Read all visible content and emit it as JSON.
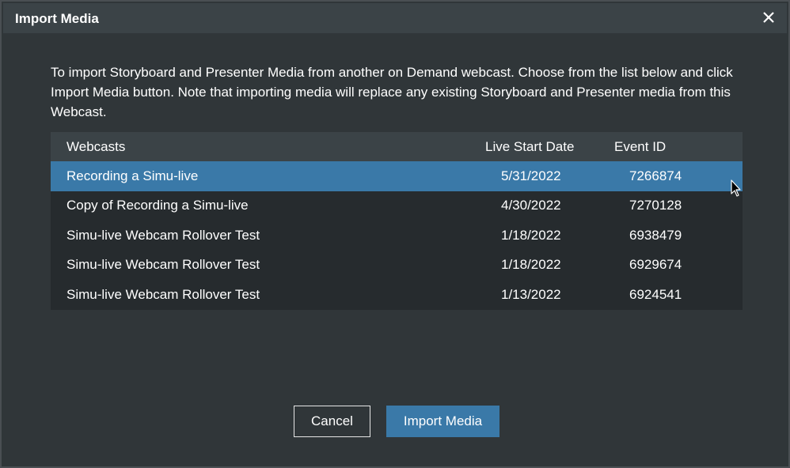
{
  "dialog": {
    "title": "Import Media",
    "description": "To import Storyboard and Presenter Media from another on Demand webcast. Choose from the list below and click Import Media button. Note that importing media will replace any existing Storyboard and Presenter media from this Webcast."
  },
  "table": {
    "headers": {
      "webcasts": "Webcasts",
      "live_start_date": "Live Start Date",
      "event_id": "Event ID"
    },
    "rows": [
      {
        "name": "Recording a Simu-live",
        "date": "5/31/2022",
        "event_id": "7266874",
        "selected": true
      },
      {
        "name": "Copy of Recording a Simu-live",
        "date": "4/30/2022",
        "event_id": "7270128",
        "selected": false
      },
      {
        "name": "Simu-live Webcam Rollover Test",
        "date": "1/18/2022",
        "event_id": "6938479",
        "selected": false
      },
      {
        "name": "Simu-live Webcam Rollover Test",
        "date": "1/18/2022",
        "event_id": "6929674",
        "selected": false
      },
      {
        "name": "Simu-live Webcam Rollover Test",
        "date": "1/13/2022",
        "event_id": "6924541",
        "selected": false
      }
    ]
  },
  "buttons": {
    "cancel": "Cancel",
    "import": "Import Media"
  },
  "icons": {
    "close": "close-icon",
    "cursor": "mouse-pointer-icon"
  },
  "colors": {
    "accent": "#3a79a8",
    "background": "#303639",
    "header": "#3b4347",
    "table_body": "#262b2e"
  }
}
